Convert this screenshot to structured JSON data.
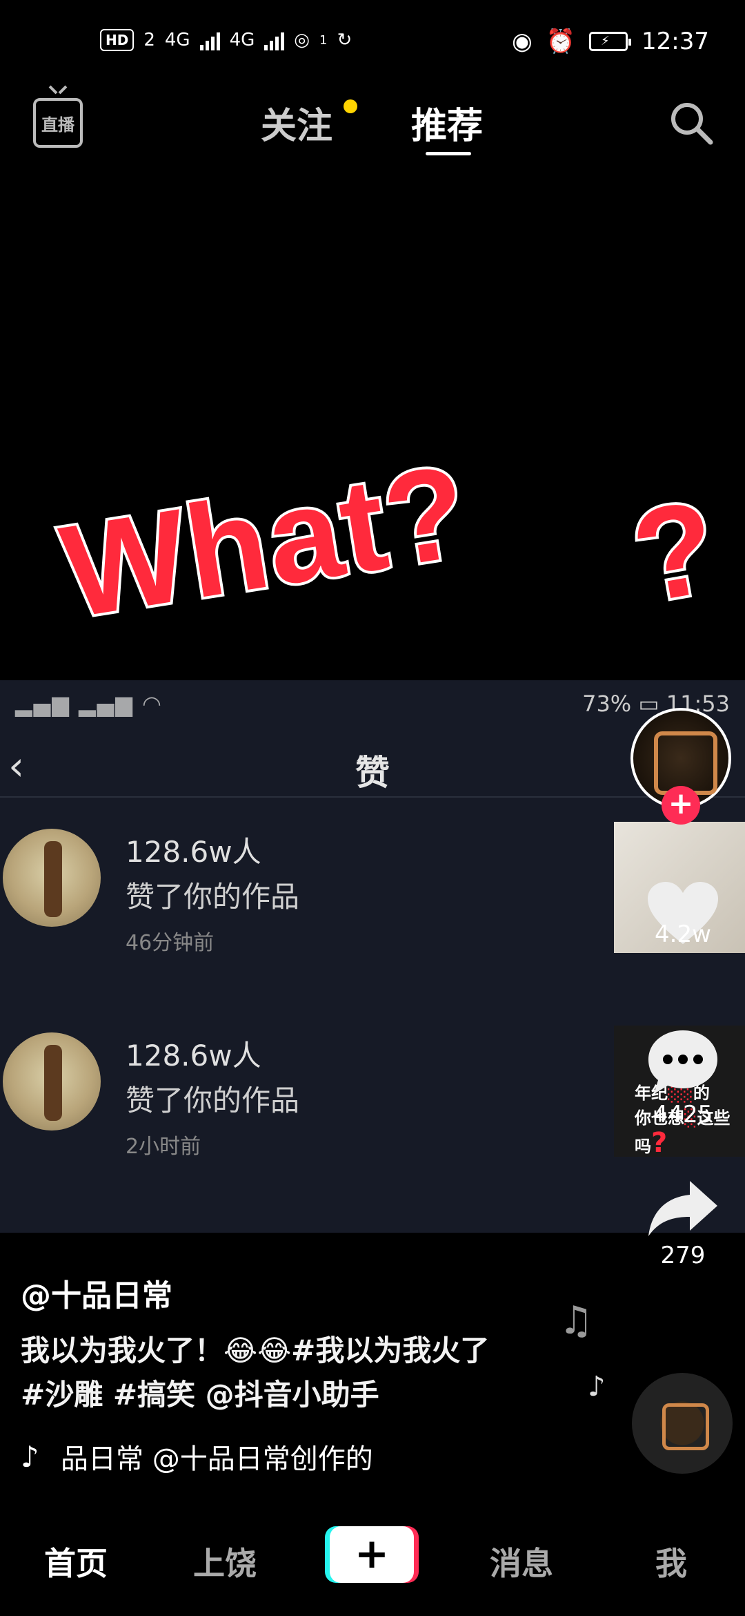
{
  "status_bar": {
    "hd_label": "HD",
    "sim_index": "2",
    "net_1": "4G",
    "net_2": "4G",
    "hotspot_count": "1",
    "time": "12:37"
  },
  "top_nav": {
    "live_label": "直播",
    "tab_follow": "关注",
    "tab_recommend": "推荐",
    "active_tab": "推荐",
    "dot_color": "#ffd400"
  },
  "video": {
    "overlay_text": "What?",
    "overlay_text_2": "?",
    "inner_status": {
      "battery": "73%",
      "time": "11:53"
    },
    "inner_title": "赞",
    "notifications": [
      {
        "count": "128.6w人",
        "message": "赞了你的作品",
        "time": "46分钟前"
      },
      {
        "count": "128.6w人",
        "message": "赞了你的作品",
        "time": "2小时前",
        "thumb_text_1": "年纪",
        "thumb_text_2": "的",
        "thumb_text_3": "你也想",
        "thumb_text_4": "这些吗"
      }
    ]
  },
  "actions": {
    "likes": "4.2w",
    "comments": "4425",
    "shares": "279"
  },
  "caption": {
    "handle": "@十品日常",
    "description_line1": "我以为我火了！😂😂#我以为我火了",
    "description_line2": "#沙雕 #搞笑 @抖音小助手",
    "music": "品日常    @十品日常创作的"
  },
  "bottom_nav": {
    "home": "首页",
    "hot": "上饶",
    "plus": "+",
    "messages": "消息",
    "me": "我"
  },
  "colors": {
    "accent_red": "#fe2c55",
    "accent_cyan": "#25f4ee",
    "overlay_red": "#ff2a3c"
  }
}
